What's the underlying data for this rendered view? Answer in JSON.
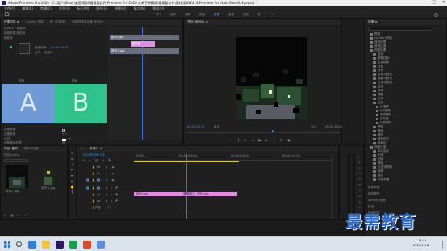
{
  "window": {
    "title": "Adobe Premiere Pro 2020 - C:\\用户\\Silkay\\桌面\\素材\\最需要软件 Premiere Pro 2020 从新手到精通\\最需要软件\\素材\\第8章\\8.4\\Premiere Pro Auto-Save\\8.4.prproj *"
  },
  "menu": [
    "文件(F)",
    "编辑(E)",
    "剪辑(C)",
    "序列(S)",
    "标记(M)",
    "图形(G)",
    "视图(V)",
    "窗口(W)",
    "帮助(H)"
  ],
  "workspaces": [
    {
      "label": "学习",
      "active": false
    },
    {
      "label": "组件",
      "active": false
    },
    {
      "label": "编辑",
      "active": false
    },
    {
      "label": "颜色",
      "active": false
    },
    {
      "label": "效果",
      "active": true
    },
    {
      "label": "音频",
      "active": false
    },
    {
      "label": "图形",
      "active": false
    },
    {
      "label": "库",
      "active": false
    }
  ],
  "effect_controls": {
    "tabs": [
      "效果控件 ≡",
      "Lumetri 范围",
      "源: (无剪辑)",
      "音频剪辑混合器: 序列01"
    ],
    "header": "序列01 * 随机块",
    "subheader": "视频效果  随机块",
    "clip_label": "序列01",
    "sample_label": "A",
    "sample_label_b": "B",
    "fx_name": "随机块",
    "motion_label": "fx 运动",
    "start_label": "开始",
    "end_label": "结束",
    "border_label": "边框宽度",
    "border_color_label": "边框颜色",
    "reverse_label": "反向",
    "aa_label": "消除锯齿品质",
    "center_label": "自定义",
    "start_value": "0.0",
    "end_value": "0.0",
    "border_value": "0.0",
    "timecode": "00:00:00:01",
    "mini_clip_a": "序列1.jpg",
    "mini_clip_b": "序列 1.jpg",
    "mini_clip_c": "序列1.jpg"
  },
  "program_monitor": {
    "tab": "节目: 序列01 ≡",
    "timecode_left": "00:00:00:01",
    "fit": "适合",
    "ratio": "1/2",
    "timecode_right": "00:00:10:01"
  },
  "project": {
    "tabs": [
      "项目: 素材",
      "媒体浏览器"
    ],
    "name": "项目.prproj",
    "thumb_a": "序列1.jpg",
    "thumb_b": "序列 1.jpg"
  },
  "timeline": {
    "tab": "序列01 ≡",
    "timecode": "00:00:00:01",
    "ruler": [
      "00:00",
      "00:00:05:00",
      "00:00:10:00",
      "00:00:15:00",
      "00:00:20:00"
    ],
    "tracks_video": [
      "V3",
      "V2",
      "V1"
    ],
    "tracks_audio": [
      "A1",
      "A2",
      "A3"
    ],
    "master": "主声道",
    "master_value": "0.0",
    "clip_a": "序列1.jpg",
    "clip_b": "序列1.jpg"
  },
  "effects": {
    "tabs": [
      "效果 ≡"
    ],
    "items": [
      {
        "label": "预设",
        "type": "folder",
        "indent": 1
      },
      {
        "label": "Lumetri 预设",
        "type": "folder",
        "indent": 1
      },
      {
        "label": "音频效果",
        "type": "folder",
        "indent": 1
      },
      {
        "label": "音频过渡",
        "type": "folder",
        "indent": 1
      },
      {
        "label": "视频效果",
        "type": "folder",
        "indent": 1
      },
      {
        "label": "变换",
        "type": "folder",
        "indent": 2
      },
      {
        "label": "图像控制",
        "type": "folder",
        "indent": 2
      },
      {
        "label": "实用程序",
        "type": "folder",
        "indent": 2
      },
      {
        "label": "扭曲",
        "type": "folder",
        "indent": 2
      },
      {
        "label": "时间",
        "type": "folder",
        "indent": 2
      },
      {
        "label": "杂色与颗粒",
        "type": "folder",
        "indent": 2
      },
      {
        "label": "模糊与锐化",
        "type": "folder",
        "indent": 2
      },
      {
        "label": "沉浸式视频",
        "type": "folder",
        "indent": 2
      },
      {
        "label": "生成",
        "type": "folder",
        "indent": 2
      },
      {
        "label": "视频",
        "type": "folder",
        "indent": 2
      },
      {
        "label": "调整",
        "type": "folder",
        "indent": 2
      },
      {
        "label": "过时",
        "type": "folder",
        "indent": 2
      },
      {
        "label": "过渡",
        "type": "folder",
        "indent": 2
      },
      {
        "label": "块溶解",
        "type": "fx",
        "indent": 3
      },
      {
        "label": "径向擦除",
        "type": "fx",
        "indent": 3
      },
      {
        "label": "渐变擦除",
        "type": "fx",
        "indent": 3
      },
      {
        "label": "百叶窗",
        "type": "fx",
        "indent": 3
      },
      {
        "label": "线性擦除",
        "type": "fx",
        "indent": 3
      },
      {
        "label": "透视",
        "type": "folder",
        "indent": 2
      },
      {
        "label": "通道",
        "type": "folder",
        "indent": 2
      },
      {
        "label": "键控",
        "type": "folder",
        "indent": 2
      },
      {
        "label": "颜色校正",
        "type": "folder",
        "indent": 2
      },
      {
        "label": "风格化",
        "type": "folder",
        "indent": 2
      },
      {
        "label": "视频过渡",
        "type": "folder",
        "indent": 1
      },
      {
        "label": "3D 运动",
        "type": "folder",
        "indent": 2
      },
      {
        "label": "内滑",
        "type": "folder",
        "indent": 2
      },
      {
        "label": "划像",
        "type": "folder",
        "indent": 2
      },
      {
        "label": "擦除",
        "type": "folder",
        "indent": 2
      },
      {
        "label": "沉浸式视频",
        "type": "folder",
        "indent": 2
      },
      {
        "label": "溶解",
        "type": "folder",
        "indent": 2
      },
      {
        "label": "缩放",
        "type": "folder",
        "indent": 2
      },
      {
        "label": "页面剥落",
        "type": "folder",
        "indent": 2
      }
    ],
    "essential_sound": "基本声音",
    "essential_graphics": "基本图形",
    "lumetri": "Lumetri 颜色",
    "markers": "标记",
    "history": "历史记录"
  },
  "taskbar": {
    "search": "",
    "time": "14:41",
    "date": "2021/10/11"
  },
  "watermark": "最需教育",
  "colors": {
    "accent": "#2d8ceb",
    "clip": "#e28ee3",
    "panelA": "#6f9ad6",
    "panelB": "#2fc28c"
  }
}
